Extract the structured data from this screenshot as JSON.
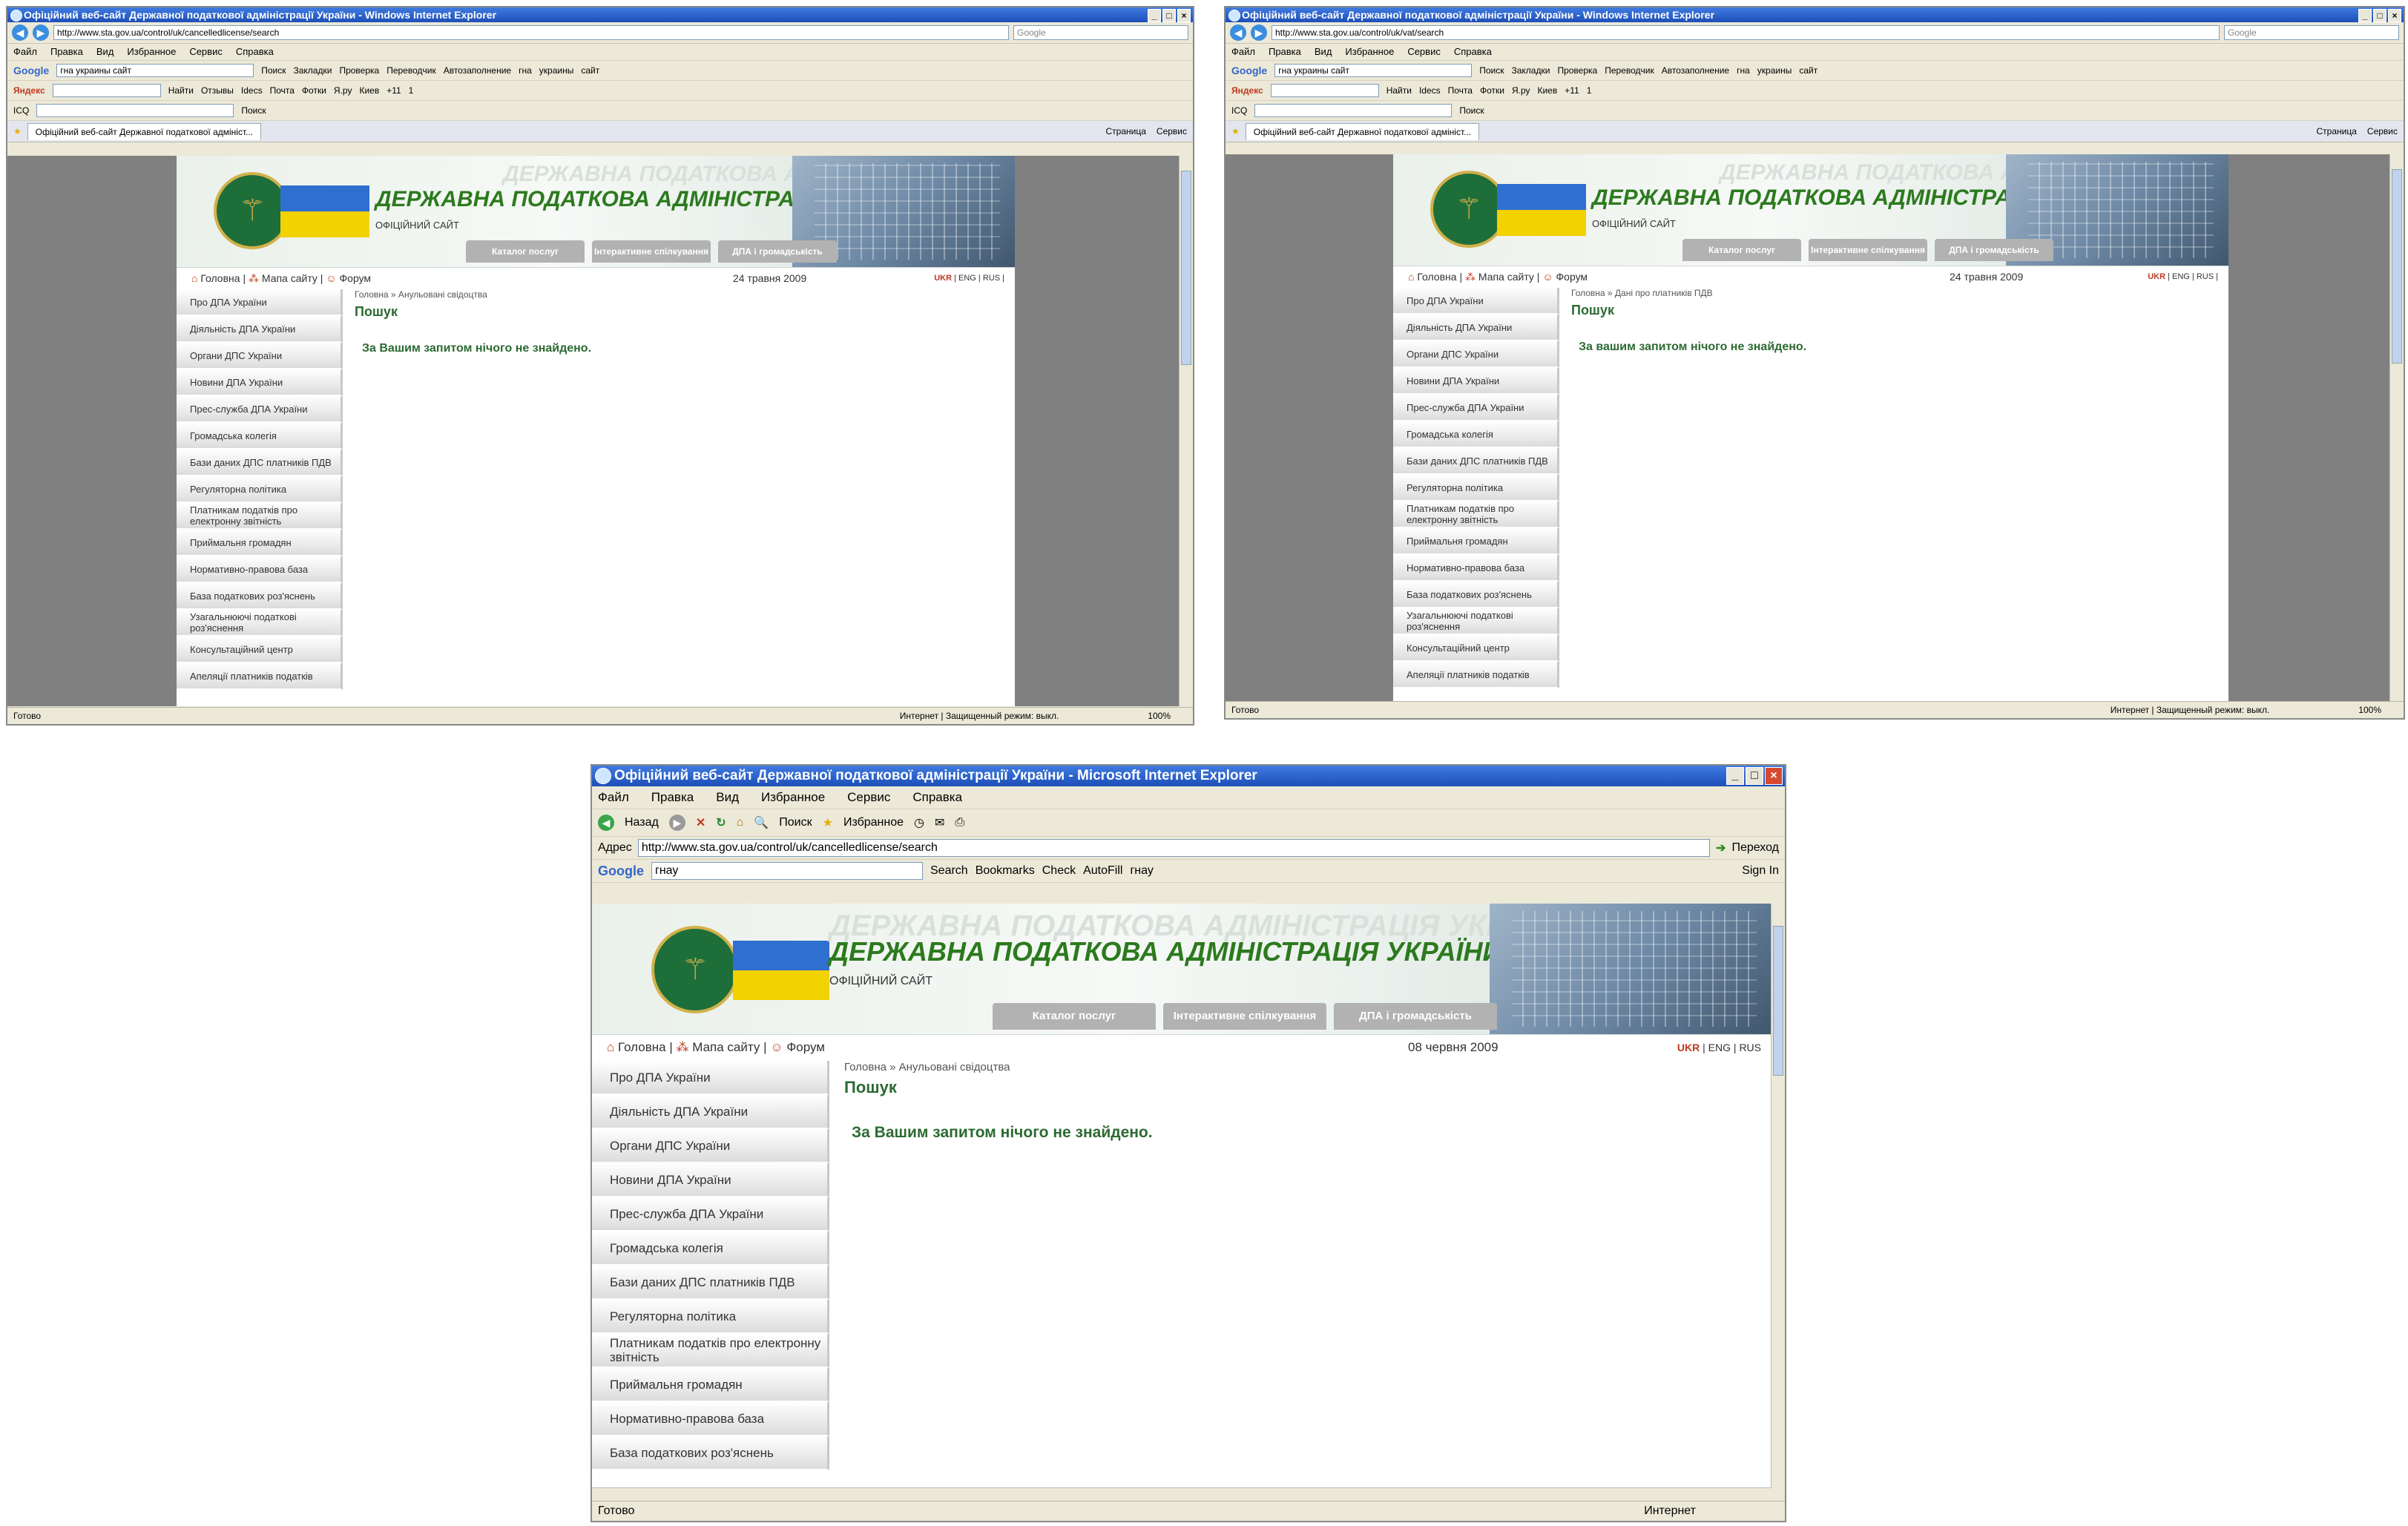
{
  "windows": [
    {
      "title": "Офіційний веб-сайт Державної податкової адміністрації України - Windows Internet Explorer",
      "url": "http://www.sta.gov.ua/control/uk/cancelledlicense/search",
      "search_placeholder": "Google",
      "menu": [
        "Файл",
        "Правка",
        "Вид",
        "Избранное",
        "Сервис",
        "Справка"
      ],
      "google_query": "гна украины сайт",
      "toolbar_items": [
        "Поиск",
        "Закладки",
        "Проверка",
        "Переводчик",
        "Автозаполнение",
        "гна",
        "украины",
        "сайт"
      ],
      "yandex_items": [
        "Найти",
        "Отзывы",
        "Idecs",
        "Почта",
        "Фотки",
        "Я.ру",
        "Киев",
        "+11",
        "1"
      ],
      "icq_items": [
        "ICQ",
        "Поиск"
      ],
      "tab_title": "Офіційний веб-сайт Державної податкової адмініст...",
      "tab_tools": [
        "Страница",
        "Сервис"
      ],
      "date": "24 травня 2009",
      "breadcrumb": "Головна »  Анульовані свідоцтва",
      "heading": "Пошук",
      "message": "За Вашим запитом нічого не знайдено.",
      "status": "Готово",
      "zone": "Интернет | Защищенный режим: выкл.",
      "zoom": "100%"
    },
    {
      "title": "Офіційний веб-сайт Державної податкової адміністрації України - Windows Internet Explorer",
      "url": "http://www.sta.gov.ua/control/uk/vat/search",
      "search_placeholder": "Google",
      "menu": [
        "Файл",
        "Правка",
        "Вид",
        "Избранное",
        "Сервис",
        "Справка"
      ],
      "google_query": "гна украины сайт",
      "toolbar_items": [
        "Поиск",
        "Закладки",
        "Проверка",
        "Переводчик",
        "Автозаполнение",
        "гна",
        "украины",
        "сайт"
      ],
      "yandex_items": [
        "Найти",
        "Idecs",
        "Почта",
        "Фотки",
        "Я.ру",
        "Киев",
        "+11",
        "1"
      ],
      "icq_items": [
        "ICQ",
        "Поиск"
      ],
      "tab_title": "Офіційний веб-сайт Державної податкової адмініст...",
      "tab_tools": [
        "Страница",
        "Сервис"
      ],
      "date": "24 травня 2009",
      "breadcrumb": "Головна »  Дані про платників ПДВ",
      "heading": "Пошук",
      "message": "За вашим запитом нічого не знайдено.",
      "status": "Готово",
      "zone": "Интернет | Защищенный режим: выкл.",
      "zoom": "100%"
    },
    {
      "title": "Офіційний веб-сайт Державної податкової адміністрації України - Microsoft Internet Explorer",
      "url": "http://www.sta.gov.ua/control/uk/cancelledlicense/search",
      "address_label": "Адрес",
      "go_label": "Переход",
      "menu": [
        "Файл",
        "Правка",
        "Вид",
        "Избранное",
        "Сервис",
        "Справка"
      ],
      "nav_items": [
        "Назад",
        "Поиск",
        "Избранное"
      ],
      "google_query": "гнау",
      "toolbar_items": [
        "Search",
        "Bookmarks",
        "Check",
        "AutoFill",
        "гнау",
        "Sign In"
      ],
      "date": "08 червня 2009",
      "breadcrumb": "Головна »  Анульовані свідоцтва",
      "heading": "Пошук",
      "message": "За Вашим запитом нічого не знайдено.",
      "status": "Готово",
      "zone": "Интернет"
    }
  ],
  "site": {
    "title": "ДЕРЖАВНА ПОДАТКОВА АДМІНІСТРАЦІЯ УКРАЇНИ",
    "subtitle": "ОФІЦІЙНИЙ САЙТ",
    "banner_tabs": [
      "Каталог послуг",
      "Інтерактивне спілкування",
      "ДПА і громадськість"
    ],
    "banner_tabs_w3": [
      "Каталог послуг",
      "Інтерактивне спілкування",
      "ДПА і громадськість"
    ],
    "top_nav": {
      "home": "Головна",
      "sitemap": "Мапа сайту",
      "forum": "Форум"
    },
    "langs": {
      "ukr": "UKR",
      "eng": "ENG",
      "rus": "RUS"
    },
    "sidebar": [
      "Про ДПА України",
      "Діяльність ДПА України",
      "Органи ДПС України",
      "Новини ДПА України",
      "Прес-служба ДПА України",
      "Громадська колегія",
      "Бази даних ДПС платників ПДВ",
      "Регуляторна політика",
      "Платникам податків про електронну звітність",
      "Приймальня громадян",
      "Нормативно-правова база",
      "База податкових роз'яснень",
      "Узагальнюючі податкові роз'яснення",
      "Консультаційний центр",
      "Апеляції платників податків"
    ]
  },
  "colors": {
    "site_green": "#2c6a32",
    "title_green": "#2c7a1e",
    "accent_red": "#c0391f",
    "xp_blue": "#1d4fb8"
  }
}
